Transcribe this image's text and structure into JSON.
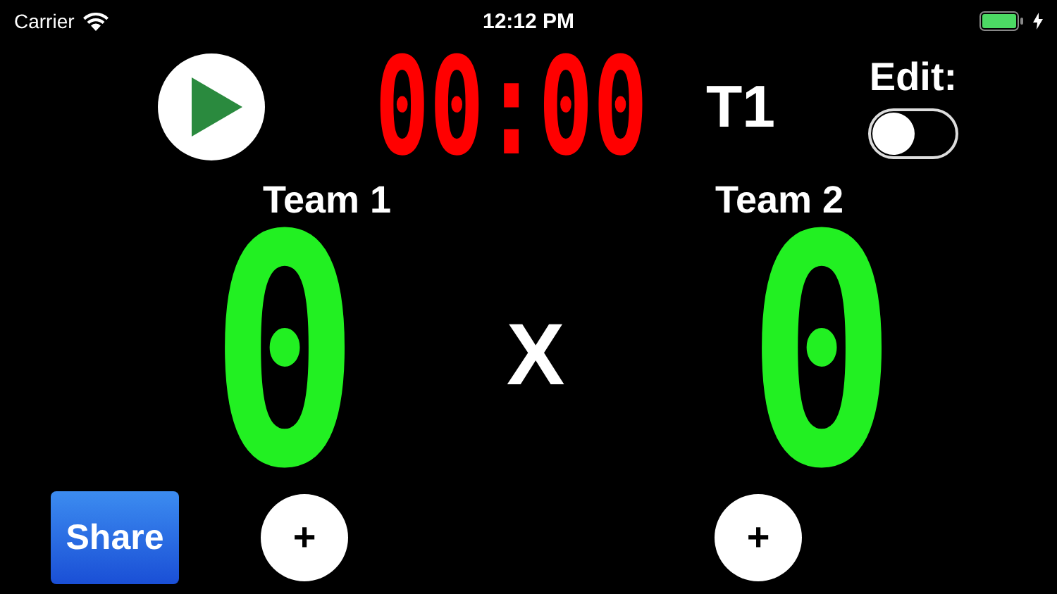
{
  "status_bar": {
    "carrier": "Carrier",
    "time": "12:12 PM"
  },
  "timer": {
    "display": "00:00",
    "period": "T1"
  },
  "edit": {
    "label": "Edit:",
    "on": false
  },
  "teams": [
    {
      "name": "Team 1",
      "score": "0",
      "plus": "+"
    },
    {
      "name": "Team 2",
      "score": "0",
      "plus": "+"
    }
  ],
  "separator": "X",
  "share_button": "Share"
}
